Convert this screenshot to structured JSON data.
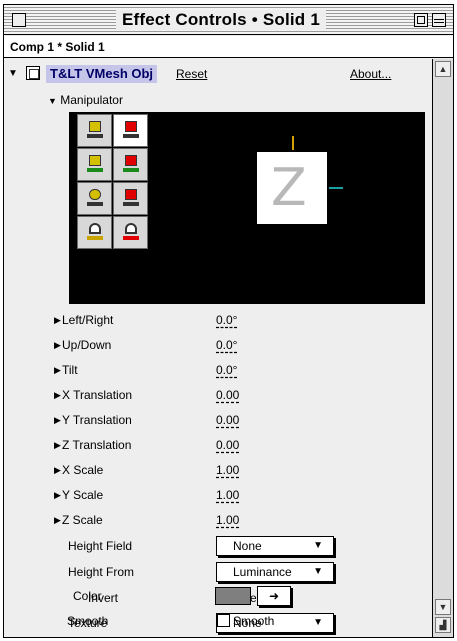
{
  "window": {
    "title": "Effect Controls • Solid 1"
  },
  "comp": {
    "label": "Comp 1 * Solid 1"
  },
  "effect": {
    "name": "T&LT VMesh Obj",
    "reset_label": "Reset",
    "about_label": "About..."
  },
  "manipulator": {
    "label": "Manipulator",
    "preview_glyph": "Z",
    "tools": [
      {
        "icon": "rotate-tool-icon",
        "selected": false
      },
      {
        "icon": "rotate-z-tool-icon",
        "selected": true
      },
      {
        "icon": "move-xy-tool-icon",
        "selected": false
      },
      {
        "icon": "move-z-tool-icon",
        "selected": false
      },
      {
        "icon": "scale-xy-tool-icon",
        "selected": false
      },
      {
        "icon": "scale-z-tool-icon",
        "selected": false
      },
      {
        "icon": "home-tool-icon",
        "selected": false
      },
      {
        "icon": "home-reset-tool-icon",
        "selected": false
      }
    ]
  },
  "params": {
    "left_right": {
      "label": "Left/Right",
      "value": "0.0°"
    },
    "up_down": {
      "label": "Up/Down",
      "value": "0.0°"
    },
    "tilt": {
      "label": "Tilt",
      "value": "0.0°"
    },
    "x_translation": {
      "label": "X Translation",
      "value": "0.00"
    },
    "y_translation": {
      "label": "Y Translation",
      "value": "0.00"
    },
    "z_translation": {
      "label": "Z Translation",
      "value": "0.00"
    },
    "x_scale": {
      "label": "X Scale",
      "value": "1.00"
    },
    "y_scale": {
      "label": "Y Scale",
      "value": "1.00"
    },
    "z_scale": {
      "label": "Z Scale",
      "value": "1.00"
    },
    "height_field": {
      "label": "Height Field",
      "value": "None"
    },
    "height_from": {
      "label": "Height From",
      "value": "Luminance"
    },
    "invert": {
      "label": "Invert",
      "checkbox_label": "Invert",
      "checked": false
    },
    "texture": {
      "label": "Texture",
      "value": "None"
    },
    "color": {
      "label": "Color",
      "value_hex": "#7f7f7f"
    },
    "smooth": {
      "label": "Smooth",
      "checkbox_label": "Smooth",
      "checked": false
    }
  },
  "colors": {
    "selection_highlight": "#c5c5ea",
    "manipulator_bg": "#000000",
    "y_axis": "#d4a000",
    "x_axis": "#1aa0a0"
  }
}
